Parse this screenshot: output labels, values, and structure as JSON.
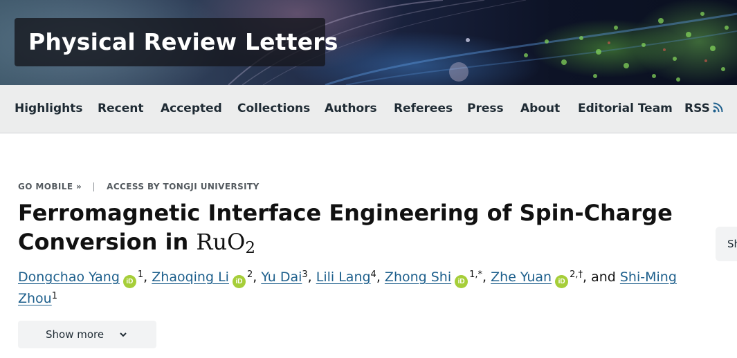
{
  "banner": {
    "journal_title": "Physical Review Letters"
  },
  "nav": {
    "items": [
      "Highlights",
      "Recent",
      "Accepted",
      "Collections",
      "Authors",
      "Referees",
      "Press",
      "About",
      "Editorial Team",
      "RSS"
    ]
  },
  "meta": {
    "go_mobile": "GO MOBILE »",
    "access": "ACCESS BY TONGJI UNIVERSITY"
  },
  "article": {
    "title_main": "Ferromagnetic Interface Engineering of Spin-Charge Conversion in",
    "title_formula_base": "RuO",
    "title_formula_sub": "2",
    "authors": [
      {
        "name": "Dongchao Yang",
        "orcid": true,
        "sup": "1",
        "sep": ", "
      },
      {
        "name": "Zhaoqing Li",
        "orcid": true,
        "sup": "2",
        "sep": ", "
      },
      {
        "name": "Yu Dai",
        "orcid": false,
        "sup": "3",
        "sep": ", "
      },
      {
        "name": "Lili Lang",
        "orcid": false,
        "sup": "4",
        "sep": ", "
      },
      {
        "name": "Zhong Shi",
        "orcid": true,
        "sup": "1,*",
        "sep": ", "
      },
      {
        "name": "Zhe Yuan",
        "orcid": true,
        "sup": "2,†",
        "sep": ", and "
      },
      {
        "name": "Shi-Ming Zhou",
        "orcid": false,
        "sup": "1",
        "sep": ""
      }
    ],
    "orcid_label": "iD",
    "show_more": "Show more",
    "side_tab": "Sh"
  },
  "colors": {
    "link": "#1d5f8c",
    "orcid": "#a6ce39",
    "nav_bg": "#eceded",
    "rss": "#1d5f8c"
  }
}
